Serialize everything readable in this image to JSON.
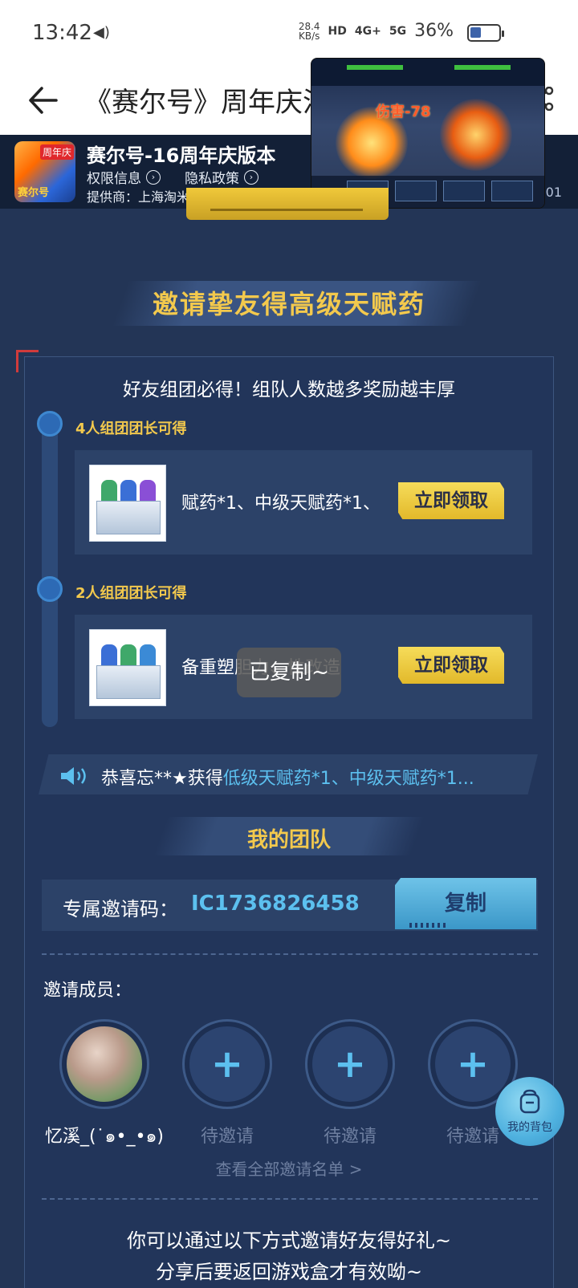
{
  "status_bar": {
    "time": "13:42",
    "net_speed_value": "28.4",
    "net_speed_unit": "KB/s",
    "signal_1": "HD",
    "signal_2": "4G+",
    "signal_3": "5G",
    "battery": "36%",
    "battery_level": 0.36
  },
  "title_bar": {
    "title": "《赛尔号》周年庆活"
  },
  "app_info": {
    "name": "赛尔号-16周年庆版本",
    "logo_badge": "周年庆",
    "logo_text": "赛尔号",
    "permissions": "权限信息",
    "privacy": "隐私政策",
    "provider": "提供商：上海淘米网络科技有限公司",
    "version": ".01"
  },
  "video": {
    "damage": "伤害-78"
  },
  "section": {
    "heading": "邀请挚友得高级天赋药",
    "subtitle": "好友组团必得！组队人数越多奖励越丰厚"
  },
  "tiers": [
    {
      "label": "4人组团团长可得",
      "reward_text": "赋药*1、中级天赋药*1、",
      "button": "立即领取"
    },
    {
      "label": "2人组团团长可得",
      "reward_text": "备重塑胆力、性改造",
      "button": "立即领取"
    }
  ],
  "toast": "已复制~",
  "announcement": {
    "prefix": "恭喜忘**★获得",
    "highlight": "低级天赋药*1、中级天赋药*1..."
  },
  "team": {
    "heading": "我的团队",
    "invite_label": "专属邀请码：",
    "invite_code": "IC1736826458",
    "copy_button": "复制",
    "members_label": "邀请成员：",
    "members": [
      {
        "name": "忆溪_(˙๑•_•๑)",
        "joined": true
      },
      {
        "name": "待邀请",
        "joined": false
      },
      {
        "name": "待邀请",
        "joined": false
      },
      {
        "name": "待邀请",
        "joined": false
      }
    ],
    "view_all": "查看全部邀请名单 >"
  },
  "backpack": {
    "label": "我的背包"
  },
  "footer": {
    "line1": "你可以通过以下方式邀请好友得好礼~",
    "line2": "分享后要返回游戏盒才有效呦~"
  },
  "colors": {
    "background": "#233556",
    "accent_gold": "#f3c94d",
    "accent_cyan": "#5cc0ef",
    "card": "#2c4268"
  }
}
